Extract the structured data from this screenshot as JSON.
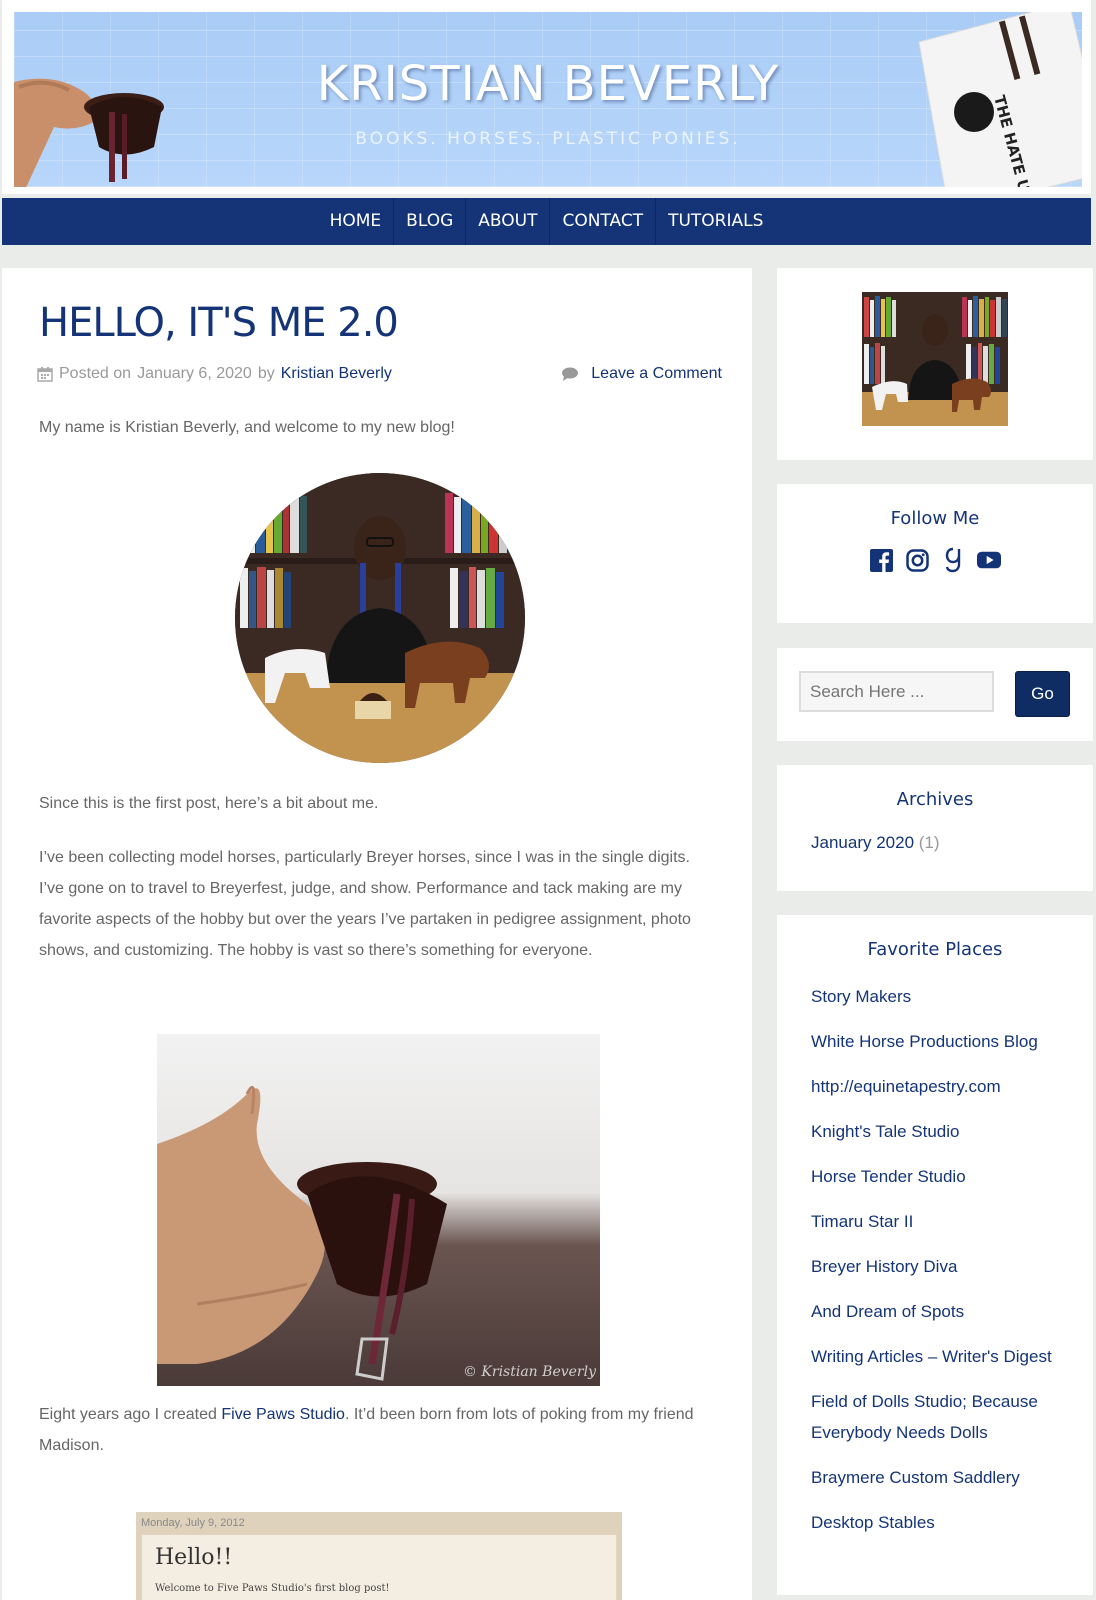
{
  "header": {
    "title": "KRISTIAN BEVERLY",
    "tagline": "BOOKS. HORSES. PLASTIC PONIES.",
    "book_cover_text": "THE HATE U GIVE"
  },
  "nav": {
    "items": [
      "HOME",
      "BLOG",
      "ABOUT",
      "CONTACT",
      "TUTORIALS"
    ]
  },
  "post": {
    "title": "HELLO, IT'S ME 2.0",
    "posted_on_label": "Posted on",
    "date": "January 6, 2020",
    "by_label": "by",
    "author": "Kristian Beverly",
    "comment_link": "Leave a Comment",
    "intro": "My name is Kristian Beverly, and welcome to my new blog!",
    "para_first": "Since this is the first post, here’s a bit about me.",
    "para_collecting": "I’ve been collecting model horses, particularly Breyer horses, since I was in the single digits. I’ve gone on to travel to Breyerfest, judge, and show. Performance and tack making are my favorite aspects of the hobby but over the years I’ve partaken in pedigree assignment, photo shows, and customizing. The hobby is vast so there’s something for everyone.",
    "photo_watermark": "© Kristian Beverly",
    "para_eight_before": "Eight years ago I created ",
    "para_eight_link": "Five Paws Studio",
    "para_eight_after": ". It’d been born from lots of poking from my friend Madison.",
    "old_blog": {
      "date": "Monday, July 9, 2012",
      "title": "Hello!!",
      "text": "Welcome to Five Paws Studio's first blog post!"
    }
  },
  "sidebar": {
    "follow": {
      "title": "Follow Me",
      "icons": [
        "facebook-icon",
        "instagram-icon",
        "goodreads-icon",
        "youtube-icon"
      ]
    },
    "search": {
      "placeholder": "Search Here ...",
      "button": "Go"
    },
    "archives": {
      "title": "Archives",
      "month": "January 2020",
      "count": "(1)"
    },
    "favorites": {
      "title": "Favorite Places",
      "links": [
        "Story Makers",
        "White Horse Productions Blog",
        "http://equinetapestry.com",
        "Knight's Tale Studio",
        "Horse Tender Studio",
        "Timaru Star II",
        "Breyer History Diva",
        "And Dream of Spots",
        "Writing Articles – Writer's Digest",
        "Field of Dolls Studio; Because Everybody Needs Dolls",
        "Braymere Custom Saddlery",
        "Desktop Stables"
      ]
    }
  },
  "colors": {
    "brand_navy": "#143477",
    "button_navy": "#0f2d63",
    "banner_blue": "#b3d2f8",
    "page_bg": "#e9ece9"
  }
}
